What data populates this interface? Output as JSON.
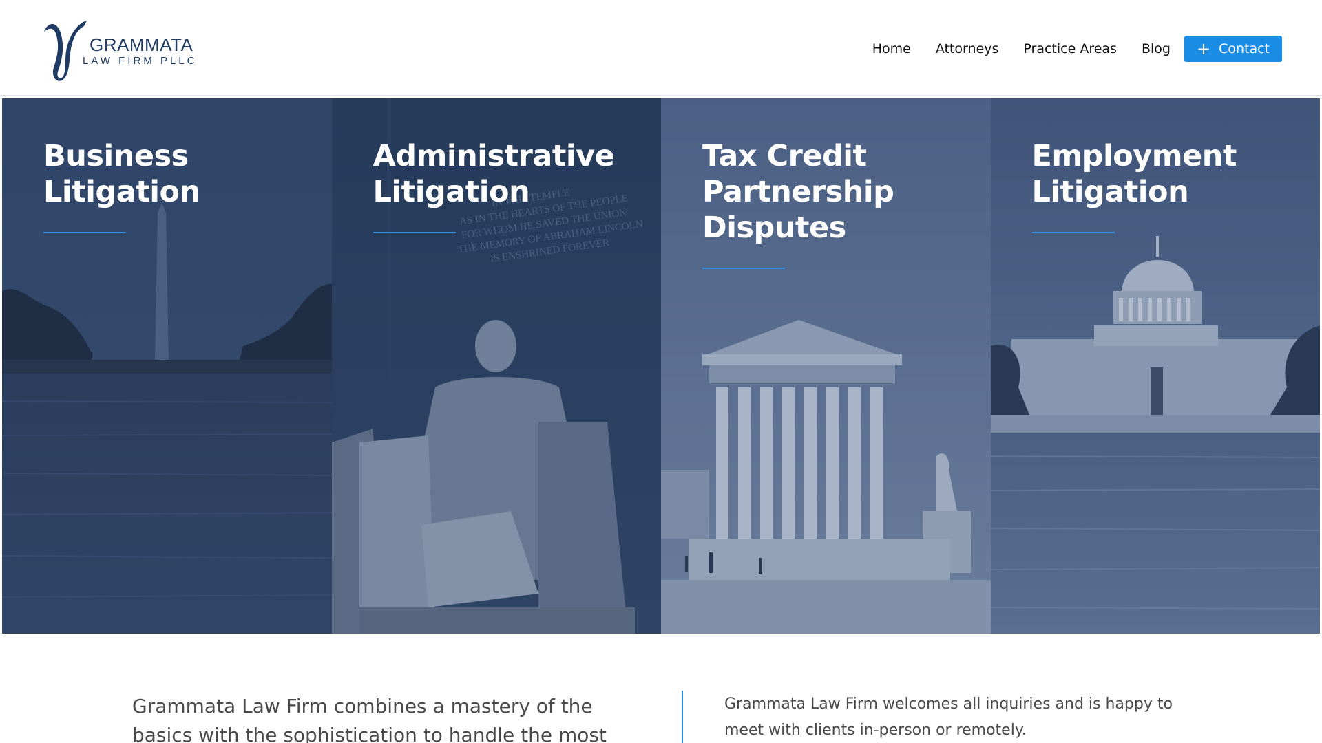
{
  "brand": {
    "name": "GRAMMATA",
    "subtitle": "LAW FIRM PLLC",
    "logo_icon": "gamma-letter-icon",
    "color": "#1f3b63"
  },
  "nav": {
    "items": [
      {
        "label": "Home"
      },
      {
        "label": "Attorneys"
      },
      {
        "label": "Practice Areas"
      },
      {
        "label": "Blog"
      }
    ],
    "contact_label": "Contact",
    "contact_icon": "plus-icon",
    "accent": "#1b8ce3"
  },
  "panels": [
    {
      "title": "Business Litigation",
      "image": "washington-monument-reflecting-pool"
    },
    {
      "title": "Administrative Litigation",
      "image": "lincoln-memorial-statue"
    },
    {
      "title": "Tax Credit Partnership Disputes",
      "image": "supreme-court-building"
    },
    {
      "title": "Employment Litigation",
      "image": "us-capitol-building"
    }
  ],
  "inscription": [
    "IN THIS TEMPLE",
    "AS IN THE HEARTS OF THE PEOPLE",
    "FOR WHOM HE SAVED THE UNION",
    "THE MEMORY OF ABRAHAM LINCOLN",
    "IS ENSHRINED FOREVER"
  ],
  "intro": {
    "left": "Grammata Law Firm combines a mastery of the basics with the sophistication to handle the most",
    "right": "Grammata Law Firm welcomes all inquiries and is happy to meet with clients in-person or remotely."
  }
}
